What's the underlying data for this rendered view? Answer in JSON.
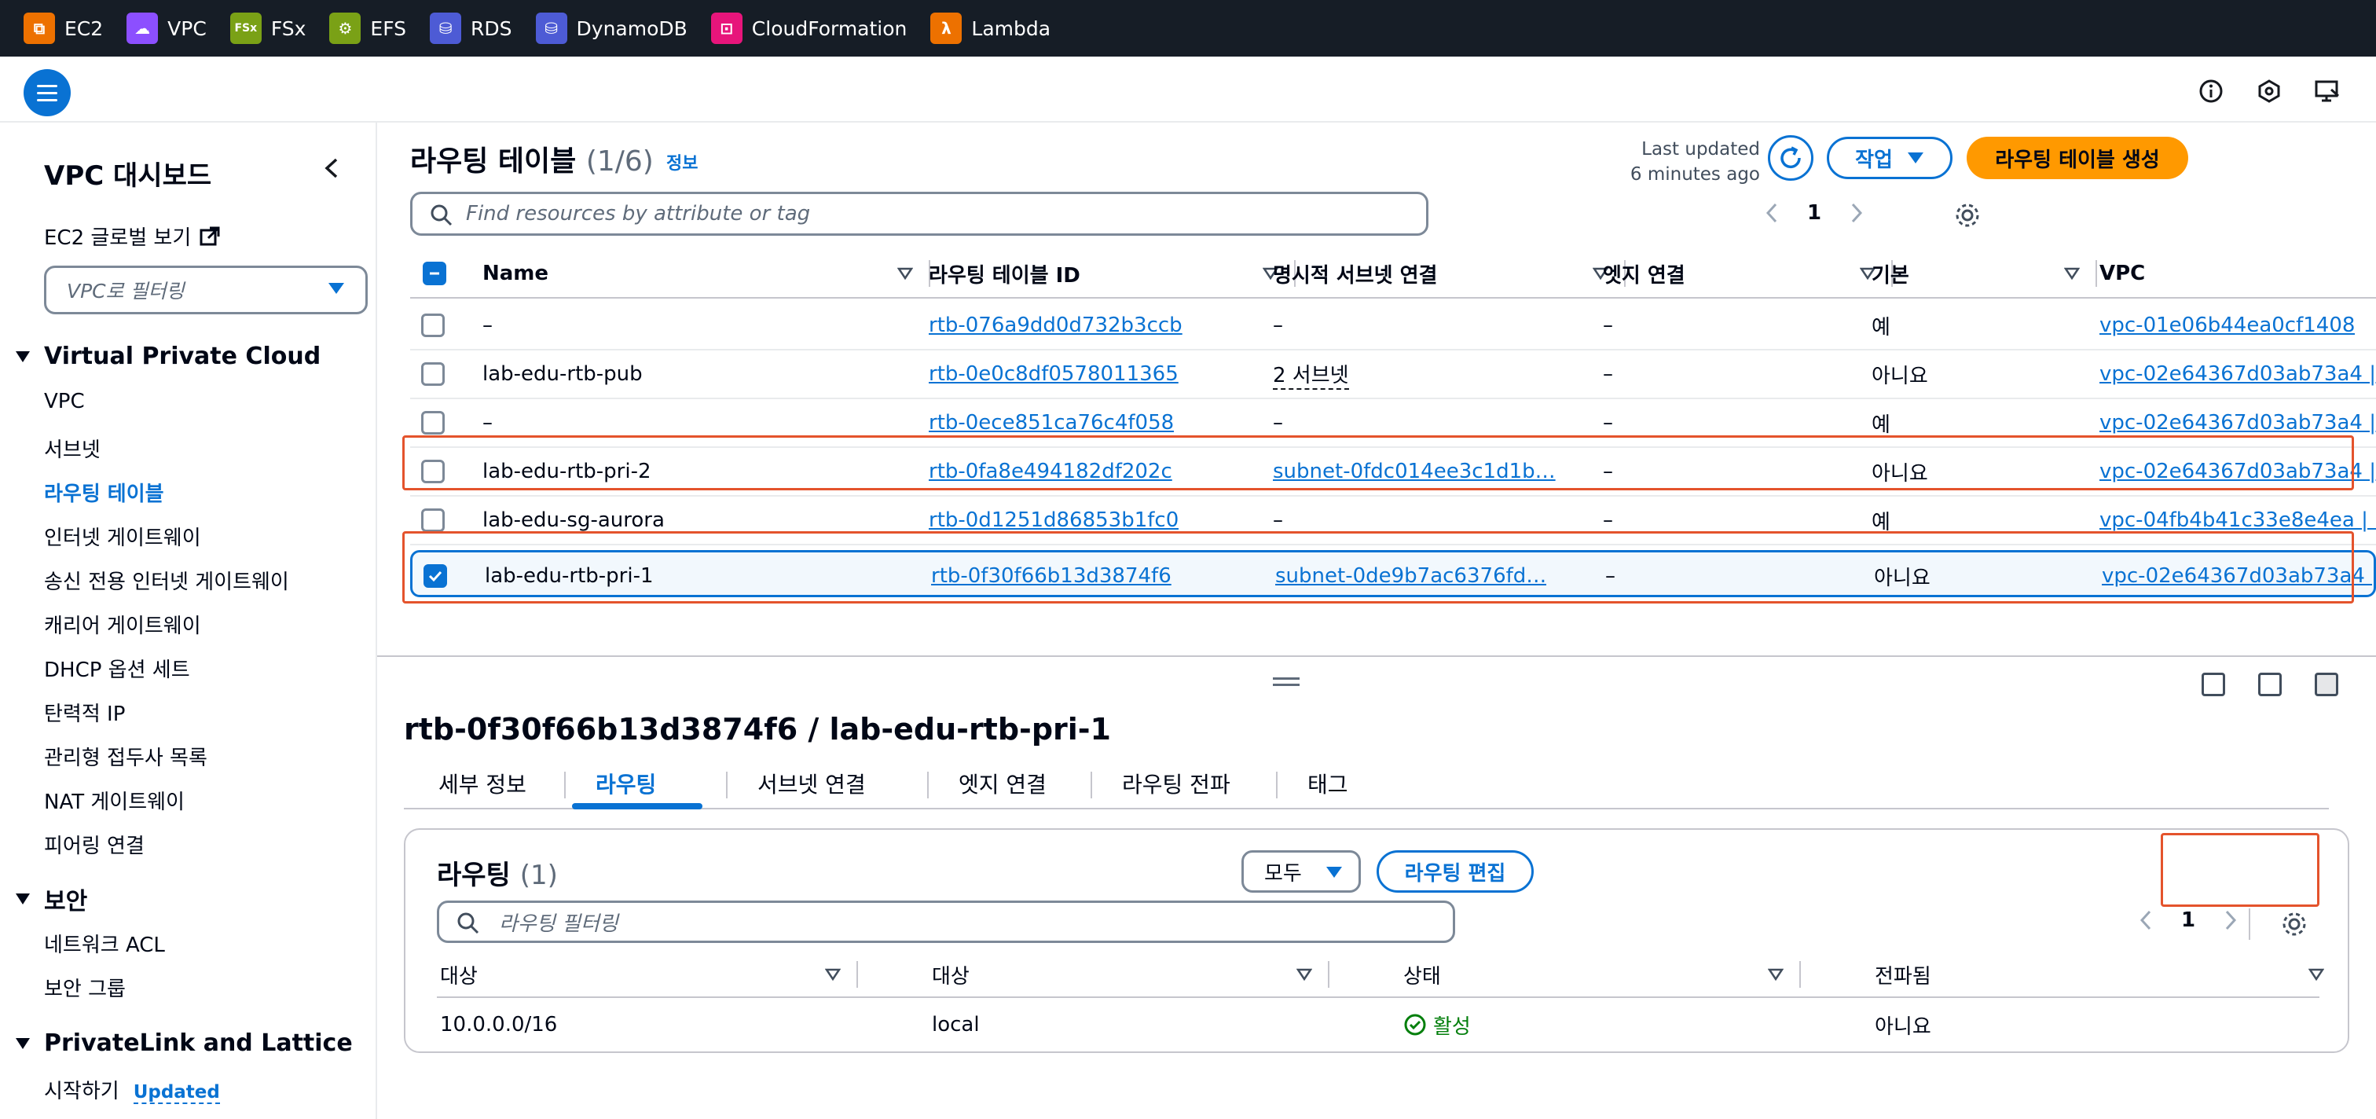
{
  "services": [
    {
      "label": "EC2",
      "icon": "ec2-icon",
      "color": "#ed7100",
      "glyph": "⧉"
    },
    {
      "label": "VPC",
      "icon": "vpc-icon",
      "color": "#8c4fff",
      "glyph": "☁"
    },
    {
      "label": "FSx",
      "icon": "fsx-icon",
      "color": "#7aa116",
      "glyph": "FSx"
    },
    {
      "label": "EFS",
      "icon": "efs-icon",
      "color": "#7aa116",
      "glyph": "⚙"
    },
    {
      "label": "RDS",
      "icon": "rds-icon",
      "color": "#4d5bd5",
      "glyph": "⛁"
    },
    {
      "label": "DynamoDB",
      "icon": "dynamodb-icon",
      "color": "#4d5bd5",
      "glyph": "⛁"
    },
    {
      "label": "CloudFormation",
      "icon": "cloudformation-icon",
      "color": "#e7157b",
      "glyph": "⊡"
    },
    {
      "label": "Lambda",
      "icon": "lambda-icon",
      "color": "#ed7100",
      "glyph": "λ"
    }
  ],
  "sidebar": {
    "title": "VPC 대시보드",
    "ec2_global": "EC2 글로벌 보기",
    "filter_placeholder": "VPC로 필터링",
    "section_vpc": "Virtual Private Cloud",
    "vpc_items": [
      "VPC",
      "서브넷",
      "라우팅 테이블",
      "인터넷 게이트웨이",
      "송신 전용 인터넷 게이트웨이",
      "캐리어 게이트웨이",
      "DHCP 옵션 세트",
      "탄력적 IP",
      "관리형 접두사 목록",
      "NAT 게이트웨이",
      "피어링 연결"
    ],
    "section_security": "보안",
    "security_items": [
      "네트워크 ACL",
      "보안 그룹"
    ],
    "section_privatelink": "PrivateLink and Lattice",
    "privatelink_item": "시작하기",
    "updated_badge": "Updated"
  },
  "main": {
    "title": "라우팅 테이블",
    "count": "(1/6)",
    "info": "정보",
    "last_updated_line1": "Last updated",
    "last_updated_line2": "6 minutes ago",
    "action_label": "작업",
    "create_label": "라우팅 테이블 생성",
    "search_placeholder": "Find resources by attribute or tag",
    "page": "1",
    "columns": [
      "Name",
      "라우팅 테이블 ID",
      "명시적 서브넷 연결",
      "엣지 연결",
      "기본",
      "VPC"
    ],
    "rows": [
      {
        "name": "–",
        "id": "rtb-076a9dd0d732b3ccb",
        "subnet": "–",
        "edge": "–",
        "main": "예",
        "vpc": "vpc-01e06b44ea0cf1408",
        "checked": false
      },
      {
        "name": "lab-edu-rtb-pub",
        "id": "rtb-0e0c8df0578011365",
        "subnet": "2 서브넷",
        "edge": "–",
        "main": "아니요",
        "vpc": "vpc-02e64367d03ab73a4 |",
        "checked": false
      },
      {
        "name": "–",
        "id": "rtb-0ece851ca76c4f058",
        "subnet": "–",
        "edge": "–",
        "main": "예",
        "vpc": "vpc-02e64367d03ab73a4 |",
        "checked": false
      },
      {
        "name": "lab-edu-rtb-pri-2",
        "id": "rtb-0fa8e494182df202c",
        "subnet": "subnet-0fdc014ee3c1d1b…",
        "edge": "–",
        "main": "아니요",
        "vpc": "vpc-02e64367d03ab73a4 |",
        "checked": false
      },
      {
        "name": "lab-edu-sg-aurora",
        "id": "rtb-0d1251d86853b1fc0",
        "subnet": "–",
        "edge": "–",
        "main": "예",
        "vpc": "vpc-04fb4b41c33e8e4ea | l",
        "checked": false
      },
      {
        "name": "lab-edu-rtb-pri-1",
        "id": "rtb-0f30f66b13d3874f6",
        "subnet": "subnet-0de9b7ac6376fd…",
        "edge": "–",
        "main": "아니요",
        "vpc": "vpc-02e64367d03ab73a4 |",
        "checked": true
      }
    ]
  },
  "detail": {
    "title": "rtb-0f30f66b13d3874f6 / lab-edu-rtb-pri-1",
    "tabs": [
      "세부 정보",
      "라우팅",
      "서브넷 연결",
      "엣지 연결",
      "라우팅 전파",
      "태그"
    ],
    "active_tab": "라우팅",
    "card_title": "라우팅",
    "card_count": "(1)",
    "all_label": "모두",
    "edit_label": "라우팅 편집",
    "filter_placeholder": "라우팅 필터링",
    "page": "1",
    "columns": [
      "대상",
      "대상",
      "상태",
      "전파됨"
    ],
    "route": {
      "destination": "10.0.0.0/16",
      "target": "local",
      "status": "활성",
      "propagated": "아니요"
    }
  },
  "colors": {
    "accent": "#0972d3",
    "primary": "#ff9900",
    "highlight": "#e4532c",
    "success": "#037f0c"
  }
}
